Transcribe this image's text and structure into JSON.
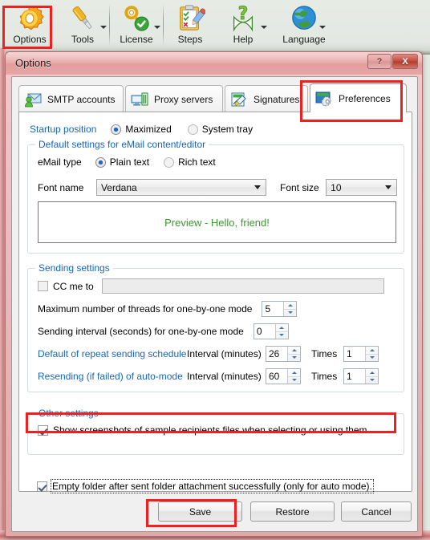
{
  "toolbar": {
    "items": [
      {
        "label": "Options",
        "icon": "gear-icon",
        "has_caret": false
      },
      {
        "label": "Tools",
        "icon": "screwdriver-icon",
        "has_caret": true
      },
      {
        "label": "License",
        "icon": "key-check-icon",
        "has_caret": true
      },
      {
        "label": "Steps",
        "icon": "clipboard-icon",
        "has_caret": false
      },
      {
        "label": "Help",
        "icon": "question-icon",
        "has_caret": true
      },
      {
        "label": "Language",
        "icon": "globe-icon",
        "has_caret": true
      }
    ]
  },
  "dialog": {
    "title": "Options",
    "help_button": "?",
    "close_button": "X"
  },
  "tabs": [
    {
      "label": "SMTP accounts",
      "icon": "smtp-accounts-icon",
      "selected": false
    },
    {
      "label": "Proxy servers",
      "icon": "proxy-servers-icon",
      "selected": false
    },
    {
      "label": "Signatures",
      "icon": "signatures-icon",
      "selected": false
    },
    {
      "label": "Preferences",
      "icon": "preferences-icon",
      "selected": true
    }
  ],
  "preferences": {
    "startup": {
      "label": "Startup position",
      "options": [
        {
          "label": "Maximized",
          "checked": true
        },
        {
          "label": "System tray",
          "checked": false
        }
      ]
    },
    "email_content": {
      "group_title": "Default settings for eMail content/editor",
      "email_type_label": "eMail type",
      "email_type_options": [
        {
          "label": "Plain text",
          "checked": true
        },
        {
          "label": "Rich text",
          "checked": false
        }
      ],
      "font_name_label": "Font name",
      "font_name_value": "Verdana",
      "font_size_label": "Font size",
      "font_size_value": "10",
      "preview_text": "Preview - Hello, friend!",
      "preview_color": "#3a9a2d"
    },
    "sending": {
      "group_title": "Sending settings",
      "cc_me_label": "CC me to",
      "cc_me_checked": false,
      "cc_me_value": "",
      "max_threads_label": "Maximum number of threads for one-by-one mode",
      "max_threads_value": "5",
      "interval_seconds_label": "Sending interval (seconds) for one-by-one mode",
      "interval_seconds_value": "0",
      "repeat_schedule_label": "Default of repeat sending schedule",
      "repeat_interval_label": "Interval (minutes)",
      "repeat_interval_value": "26",
      "repeat_times_label": "Times",
      "repeat_times_value": "1",
      "resend_label": "Resending (if failed) of auto-mode",
      "resend_interval_label": "Interval (minutes)",
      "resend_interval_value": "60",
      "resend_times_label": "Times",
      "resend_times_value": "1",
      "empty_folder_label": "Empty folder after sent folder attachment successfully (only for auto mode).",
      "empty_folder_checked": true
    },
    "other": {
      "group_title": "Other settings",
      "show_screenshots_label": "Show screenshots of sample recipients files when selecting or using them.",
      "show_screenshots_checked": true
    }
  },
  "buttons": {
    "save": "Save",
    "restore": "Restore",
    "cancel": "Cancel"
  },
  "highlights": {
    "color": "#f02020",
    "targets": [
      "options-toolbar-button",
      "preferences-tab",
      "empty-folder-checkbox",
      "save-button"
    ]
  }
}
